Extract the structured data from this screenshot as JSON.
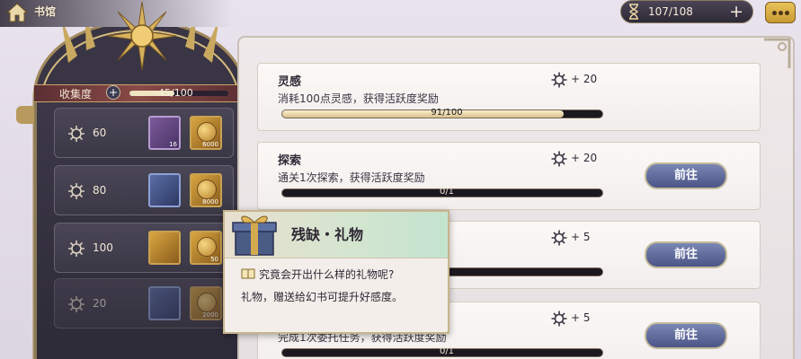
{
  "header": {
    "home_label": "书馆",
    "currency_value": "107/108",
    "plus_label": "+"
  },
  "collection": {
    "label": "收集度",
    "current": 45,
    "max": 100,
    "value_text": "45/100"
  },
  "milestones": [
    {
      "threshold": "60",
      "items": [
        "purple",
        "gold"
      ],
      "item_qty": [
        "16",
        "6000"
      ],
      "dimmed": false
    },
    {
      "threshold": "80",
      "items": [
        "blue",
        "gold"
      ],
      "item_qty": [
        "",
        "8000"
      ],
      "dimmed": false
    },
    {
      "threshold": "100",
      "items": [
        "gold",
        "gold"
      ],
      "item_qty": [
        "",
        "50"
      ],
      "dimmed": false
    },
    {
      "threshold": "20",
      "items": [
        "blue",
        "gold"
      ],
      "item_qty": [
        "",
        "2000"
      ],
      "dimmed": true
    }
  ],
  "tasks": [
    {
      "title": "灵感",
      "desc": "消耗100点灵感，获得活跃度奖励",
      "reward": "+ 20",
      "progress": 0.91,
      "progress_text": "91/100",
      "button": ""
    },
    {
      "title": "探索",
      "desc": "通关1次探索，获得活跃度奖励",
      "reward": "+ 20",
      "progress": 0,
      "progress_text": "0/1",
      "button": "前往"
    },
    {
      "title": "",
      "desc": "",
      "reward": "+ 5",
      "progress": 0,
      "progress_text": "",
      "button": "前往"
    },
    {
      "title": "",
      "desc": "完成1次委托任务，获得活跃度奖励",
      "reward": "+ 5",
      "progress": 0,
      "progress_text": "0/1",
      "button": "前往"
    }
  ],
  "popup": {
    "title": "残缺・礼物",
    "question": "究竟会开出什么样的礼物呢?",
    "description": "礼物，赠送给幻书可提升好感度。"
  }
}
